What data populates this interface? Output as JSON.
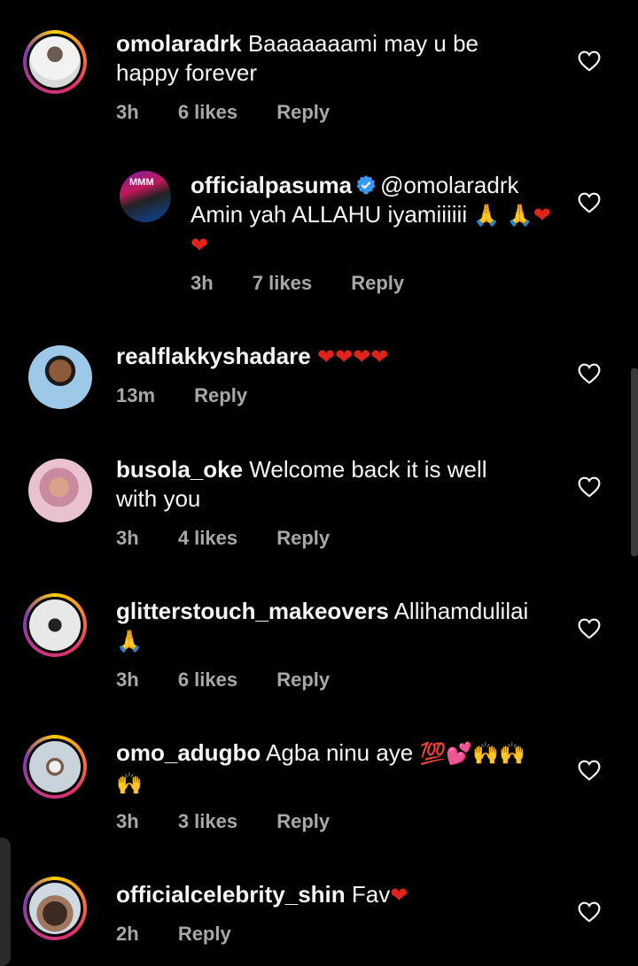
{
  "comments": [
    {
      "username": "omolaradrk",
      "text": "Baaaaaaami may u be happy forever",
      "time": "3h",
      "likes": "6 likes",
      "reply": "Reply"
    },
    {
      "username": "officialpasuma",
      "mention": "@omolaradrk",
      "text": "Amin yah ALLAHU iyamiiiiii",
      "emojis": "🙏 🙏❤❤",
      "time": "3h",
      "likes": "7 likes",
      "reply": "Reply",
      "avatar_label": "MMM"
    },
    {
      "username": "realflakkyshadare",
      "emojis": "❤❤❤❤",
      "time": "13m",
      "reply": "Reply"
    },
    {
      "username": "busola_oke",
      "text": "Welcome back it is well with you",
      "time": "3h",
      "likes": "4 likes",
      "reply": "Reply"
    },
    {
      "username": "glitterstouch_makeovers",
      "text": "Allihamdulilai",
      "emojis": "🙏",
      "time": "3h",
      "likes": "6 likes",
      "reply": "Reply"
    },
    {
      "username": "omo_adugbo",
      "text": "Agba ninu aye",
      "emojis": "💯💕🙌🙌 🙌",
      "time": "3h",
      "likes": "3 likes",
      "reply": "Reply"
    },
    {
      "username": "officialcelebrity_shin",
      "text": "Fav",
      "emojis": "❤",
      "time": "2h",
      "reply": "Reply"
    }
  ],
  "colors": {
    "background": "#000000",
    "text": "#f5f5f5",
    "meta": "#a8a8a8",
    "verified": "#3897f0",
    "heart_emoji": "#e0241b"
  }
}
